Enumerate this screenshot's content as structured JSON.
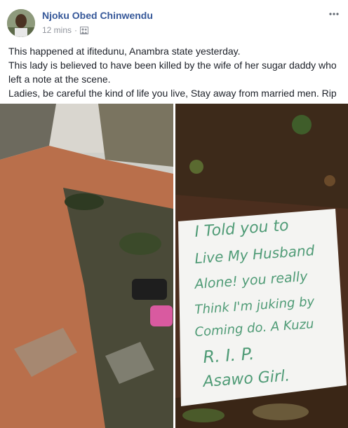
{
  "post": {
    "author": "Njoku Obed Chinwendu",
    "timestamp": "12 mins",
    "audience_icon": "friends-audience-icon",
    "more_icon": "more-dots-icon",
    "text": [
      "This happened at ifitedunu, Anambra state yesterday.",
      "This lady is believed to have been killed by the wife of her sugar daddy who left a note at the scene.",
      "Ladies, be careful the kind of life you live, Stay away from married men. Rip"
    ]
  },
  "photos": {
    "right_note": {
      "lines": [
        "I Told you to",
        "Live My Husband",
        "Alone! you really",
        "Think I'm juking by",
        "Coming do. A Kuzu",
        "R. I. P.",
        "Asawo Girl."
      ],
      "ink_color": "#4f9b76"
    }
  },
  "colors": {
    "link": "#365899",
    "meta": "#90949c",
    "text": "#1d2129"
  }
}
